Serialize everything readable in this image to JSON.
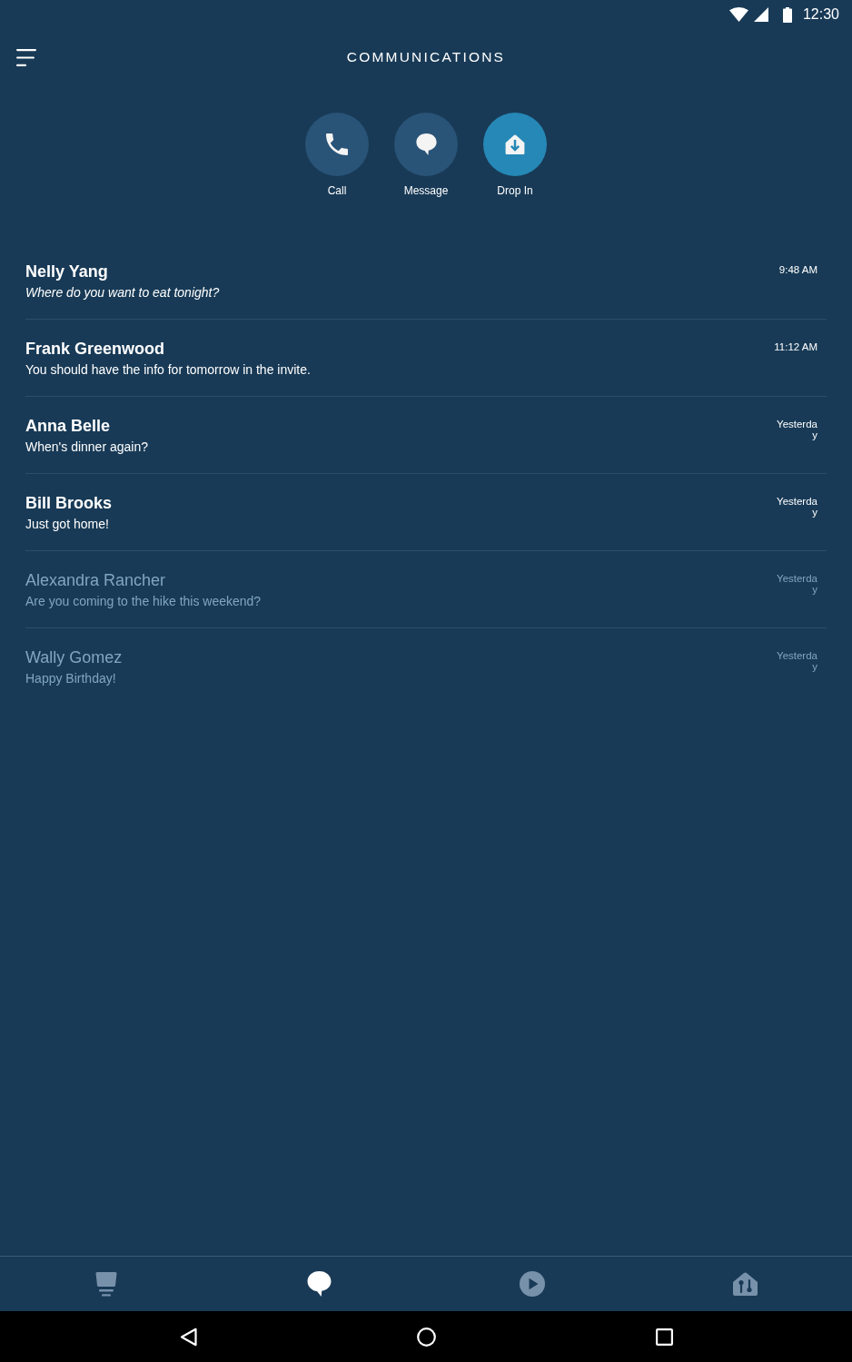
{
  "status_bar": {
    "time": "12:30"
  },
  "header": {
    "title": "COMMUNICATIONS"
  },
  "actions": [
    {
      "label": "Call",
      "color": "#295377"
    },
    {
      "label": "Message",
      "color": "#295377"
    },
    {
      "label": "Drop In",
      "color": "#2688b6"
    }
  ],
  "conversations": [
    {
      "name": "Nelly Yang",
      "preview": "Where do you want to eat tonight?",
      "time": "9:48 AM",
      "unread": true,
      "kind": "emphasized"
    },
    {
      "name": "Frank Greenwood",
      "preview": "You should have the info for tomorrow in the invite.",
      "time": "11:12 AM",
      "unread": true,
      "kind": "plain"
    },
    {
      "name": "Anna Belle",
      "preview": "When's dinner again?",
      "time": "Yesterday",
      "unread": true,
      "kind": "plain"
    },
    {
      "name": "Bill Brooks",
      "preview": "Just got home!",
      "time": "Yesterday",
      "unread": true,
      "kind": "plain"
    },
    {
      "name": "Alexandra Rancher",
      "preview": "Are you coming to the hike this weekend?",
      "time": "Yesterday",
      "unread": false,
      "kind": "plain"
    },
    {
      "name": "Wally Gomez",
      "preview": "Happy Birthday!",
      "time": "Yesterday",
      "unread": false,
      "kind": "plain"
    }
  ],
  "bottom_nav": [
    {
      "selected": false
    },
    {
      "selected": true
    },
    {
      "selected": false
    },
    {
      "selected": false
    }
  ]
}
